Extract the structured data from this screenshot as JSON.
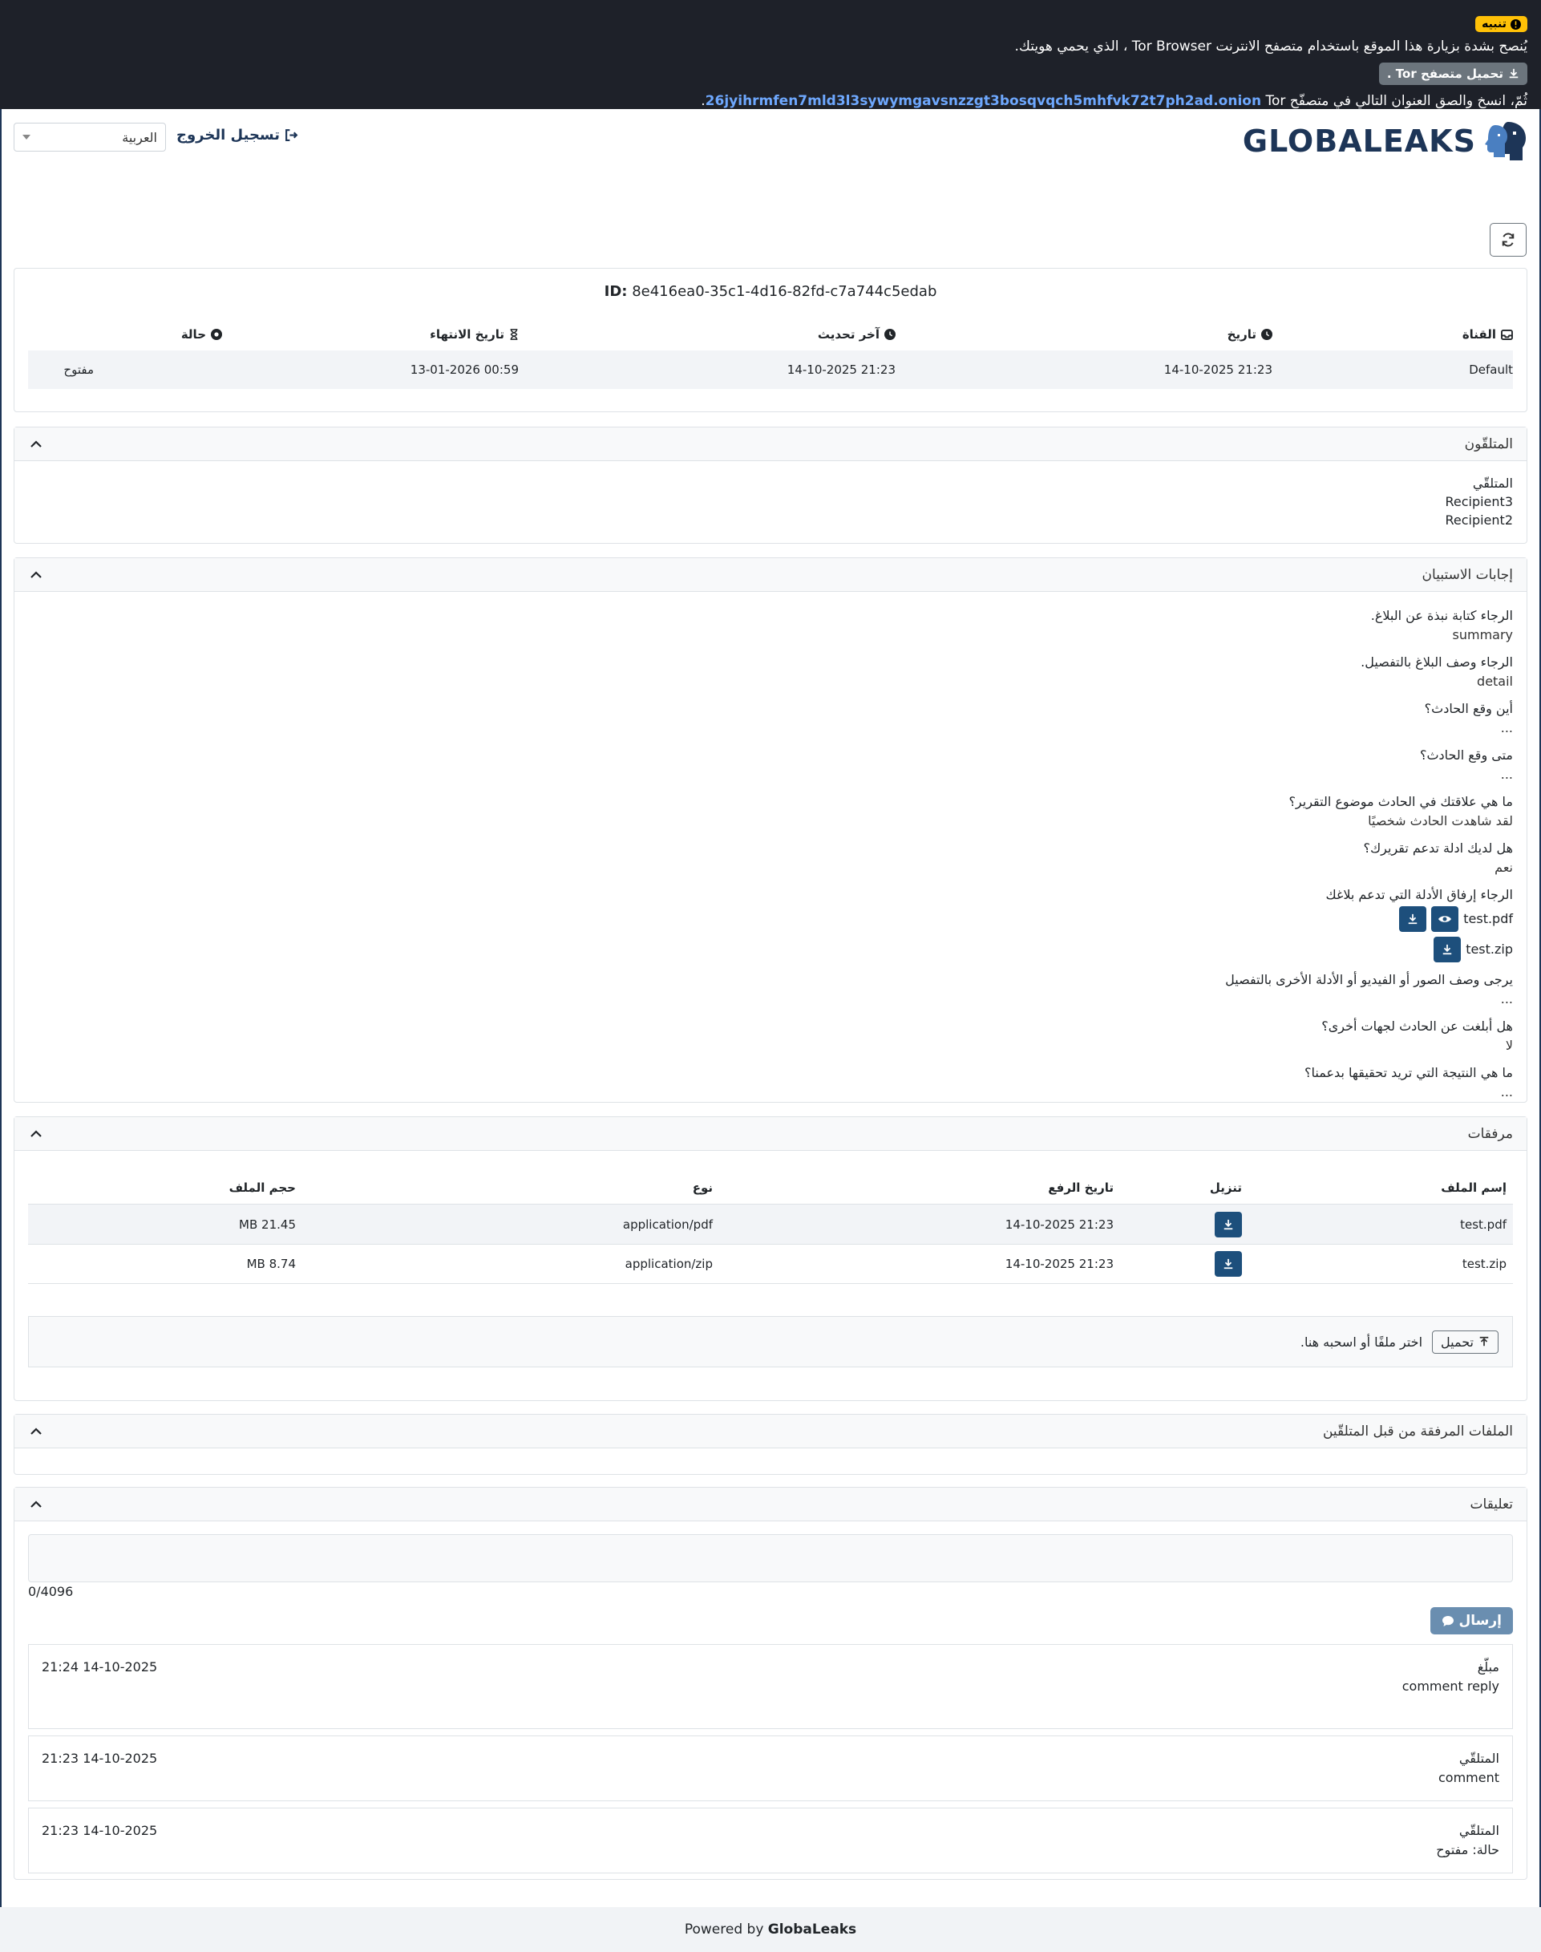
{
  "banner": {
    "badge": "تنبيه",
    "message": "يُنصح بشدة بزيارة هذا الموقع باستخدام متصفح الانترنت Tor Browser ، الذي يحمي هويتك.",
    "tor_button": "تحميل متصفح Tor .",
    "copy_prefix": "ثُمّ، انسخ والصق العنوان التالي في متصفّح",
    "onion": "26jyihrmfen7mld3l3sywymgavsnzzgt3bosqvqch5mhfvk72t7ph2ad.onion",
    "copy_suffix": "Tor."
  },
  "header": {
    "logo_text": "GLOBALEAKS",
    "logout": "تسجيل الخروج",
    "language": "العربية"
  },
  "report": {
    "id_label": "ID:",
    "id_value": "8e416ea0-35c1-4d16-82fd-c7a744c5edab",
    "columns": [
      "القناة",
      "تاريخ",
      "آخر تحديث",
      "تاريخ الانتهاء",
      "حالة"
    ],
    "values": [
      "Default",
      "21:23 14-10-2025",
      "21:23 14-10-2025",
      "00:59 13-01-2026",
      "مفتوح"
    ]
  },
  "recipients": {
    "title": "المتلقّون",
    "label": "المتلقّي",
    "items": [
      "Recipient3",
      "Recipient2"
    ]
  },
  "answers": {
    "title": "إجابات الاستبيان",
    "q1": "الرجاء كتابة نبذة عن البلاغ.",
    "a1": "summary",
    "q2": "الرجاء وصف البلاغ بالتفصيل.",
    "a2": "detail",
    "q3": "أين وقع الحادث؟",
    "a3": "...",
    "q4": "متى وقع الحادث؟",
    "a4": "...",
    "q5": "ما هي علاقتك في الحادث موضوع التقرير؟",
    "a5": "لقد شاهدت الحادث شخصيًا",
    "q6": "هل لديك ادلة تدعم تقريرك؟",
    "a6": "نعم",
    "q7": "الرجاء إرفاق الأدلة التي تدعم بلاغك",
    "file1": "test.pdf",
    "file2": "test.zip",
    "q8": "يرجى وصف الصور أو الفيديو أو الأدلة الأخرى بالتفصيل",
    "a8": "...",
    "q9": "هل أبلغت عن الحادث لجهات أخرى؟",
    "a9": "لا",
    "q10": "ما هي النتيجة التي تريد تحقيقها بدعمنا؟",
    "a10": "..."
  },
  "attachments": {
    "title": "مرفقات",
    "headers": {
      "name": "إسم الملف",
      "download": "تنزيل",
      "date": "تاريخ الرفع",
      "type": "نوع",
      "size": "حجم الملف"
    },
    "rows": [
      {
        "name": "test.pdf",
        "date": "21:23 14-10-2025",
        "type": "application/pdf",
        "size": "21.45 MB"
      },
      {
        "name": "test.zip",
        "date": "21:23 14-10-2025",
        "type": "application/zip",
        "size": "8.74 MB"
      }
    ],
    "upload_button": "تحميل",
    "upload_hint": "اختر ملفًا أو اسحبه هنا."
  },
  "recipient_files": {
    "title": "الملفات المرفقة من قبل المتلقّين"
  },
  "comments": {
    "title": "تعليقات",
    "counter": "0/4096",
    "send": "إرسال",
    "items": [
      {
        "author": "مبلّغ",
        "text": "comment reply",
        "time": "21:24 14-10-2025"
      },
      {
        "author": "المتلقّي",
        "text": "comment",
        "time": "21:23 14-10-2025"
      },
      {
        "author": "المتلقّي",
        "text": "حالة: مفتوح",
        "time": "21:23 14-10-2025"
      }
    ]
  },
  "footer": {
    "prefix": "Powered by",
    "brand": "GlobaLeaks"
  },
  "colors": {
    "banner_bg": "#1e2129",
    "brand": "#1d3557",
    "button_primary": "#1d4f7c",
    "warning": "#ffc107",
    "onion_link": "#6ea8fe"
  }
}
